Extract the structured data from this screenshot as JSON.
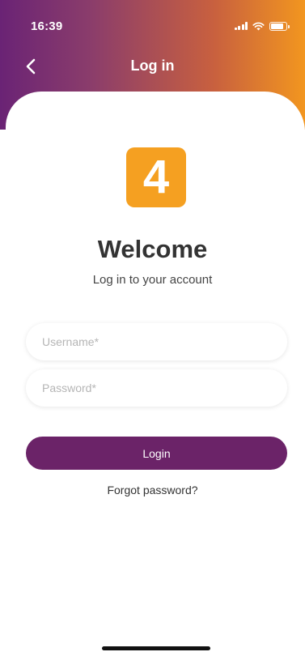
{
  "status_bar": {
    "time": "16:39",
    "signal_icon": "cellular-signal-icon",
    "wifi_icon": "wifi-icon",
    "battery_icon": "battery-icon",
    "battery_level": 0.85
  },
  "nav": {
    "back_icon": "chevron-left-icon",
    "title": "Log in"
  },
  "logo": {
    "text": "4",
    "color": "#f5a021"
  },
  "welcome": {
    "title": "Welcome",
    "subtitle": "Log in to your account"
  },
  "form": {
    "username": {
      "value": "",
      "placeholder": "Username*"
    },
    "password": {
      "value": "",
      "placeholder": "Password*"
    },
    "login_label": "Login",
    "forgot_label": "Forgot password?"
  },
  "colors": {
    "gradient_start": "#6a2375",
    "gradient_end": "#f2961f",
    "primary": "#6b2368",
    "logo_bg": "#f5a021"
  }
}
